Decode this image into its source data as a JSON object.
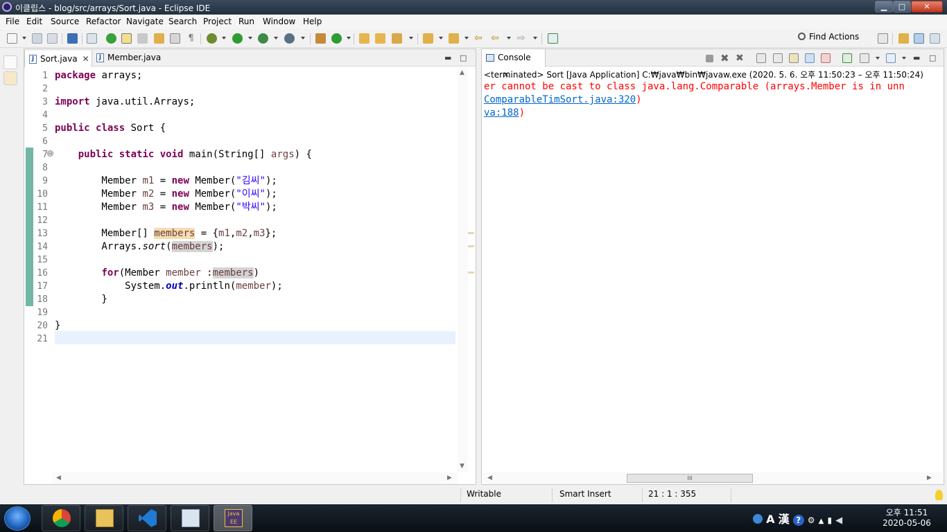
{
  "window": {
    "title": "이클립스 - blog/src/arrays/Sort.java - Eclipse IDE",
    "minimize_glyph": "▁",
    "maximize_glyph": "□",
    "close_glyph": "✕"
  },
  "menu": [
    "File",
    "Edit",
    "Source",
    "Refactor",
    "Navigate",
    "Search",
    "Project",
    "Run",
    "Window",
    "Help"
  ],
  "toolbar": {
    "find_actions_label": "Find Actions",
    "colors": {
      "green": "#3aa03a",
      "blue": "#3b6fb6",
      "orange": "#e19a2c",
      "gray": "#777777"
    }
  },
  "editor": {
    "tabs": [
      {
        "label": "Sort.java",
        "active": true,
        "close": "✕"
      },
      {
        "label": "Member.java",
        "active": false
      }
    ],
    "line_numbers": [
      "1",
      "2",
      "3",
      "4",
      "5",
      "6",
      "7",
      "8",
      "9",
      "10",
      "11",
      "12",
      "13",
      "14",
      "15",
      "16",
      "17",
      "18",
      "19",
      "20",
      "21"
    ],
    "lines": [
      {
        "p1": "package",
        "p2": " arrays;"
      },
      {},
      {
        "p1": "import",
        "p2": " java.util.Arrays;"
      },
      {},
      {
        "p1": "public",
        "p2": " ",
        "p3": "class",
        "p4": " Sort {"
      },
      {},
      {
        "p0": "    ",
        "p1": "public",
        "p2": " ",
        "p3": "static",
        "p4": " ",
        "p5": "void",
        "p6": " main(String[] ",
        "p7": "args",
        "p8": ") {"
      },
      {},
      {
        "p0": "        Member ",
        "p1": "m1",
        "p2": " = ",
        "p3": "new",
        "p4": " Member(",
        "p5": "\"김씨\"",
        "p6": ");"
      },
      {
        "p0": "        Member ",
        "p1": "m2",
        "p2": " = ",
        "p3": "new",
        "p4": " Member(",
        "p5": "\"이씨\"",
        "p6": ");"
      },
      {
        "p0": "        Member ",
        "p1": "m3",
        "p2": " = ",
        "p3": "new",
        "p4": " Member(",
        "p5": "\"박씨\"",
        "p6": ");"
      },
      {},
      {
        "p0": "        Member[] ",
        "p1": "members",
        "p2": " = {",
        "p3": "m1",
        "p4": ",",
        "p5": "m2",
        "p6": ",",
        "p7": "m3",
        "p8": "};"
      },
      {
        "p0": "        Arrays.",
        "p1": "sort",
        "p2": "(",
        "p3": "members",
        "p4": ");"
      },
      {},
      {
        "p0": "        ",
        "p1": "for",
        "p2": "(Member ",
        "p3": "member",
        "p4": " :",
        "p5": "members",
        "p6": ")"
      },
      {
        "p0": "            System.",
        "p1": "out",
        "p2": ".println(",
        "p3": "member",
        "p4": ");"
      },
      {
        "p0": "        }"
      },
      {},
      {
        "p0": "}"
      },
      {}
    ],
    "fold_glyph": "⊖",
    "vscroll": {
      "up": "▲",
      "down": "▼"
    },
    "hscroll": {
      "left": "◀",
      "right": "▶"
    }
  },
  "console": {
    "tab_label": "Console",
    "close": "✕",
    "terminated_line": "<terminated> Sort [Java Application] C:₩java₩bin₩javaw.exe  (2020. 5. 6. 오후 11:50:23 – 오후 11:50:24)",
    "output": [
      {
        "error": "er cannot be cast to class java.lang.Comparable (arrays.Member is in unn"
      },
      {
        "link": "ComparableTimSort.java:320",
        "error": ")"
      },
      {
        "link": "va:188",
        "error": ")"
      }
    ],
    "hscroll": {
      "left": "◀",
      "right": "▶",
      "thumb": "III"
    }
  },
  "status": {
    "writable": "Writable",
    "insert_mode": "Smart Insert",
    "position": "21 : 1 : 355"
  },
  "taskbar": {
    "apps": [
      "chrome",
      "file-explorer",
      "visual-studio-code",
      "deployment-manager",
      "eclipse-java-ee"
    ],
    "eclipse_label": "Java EE IDE",
    "tray": {
      "ime_letter": "A",
      "ime_hanja": "漢",
      "help": "?"
    },
    "clock_time": "오후 11:51",
    "clock_date": "2020-05-06"
  }
}
